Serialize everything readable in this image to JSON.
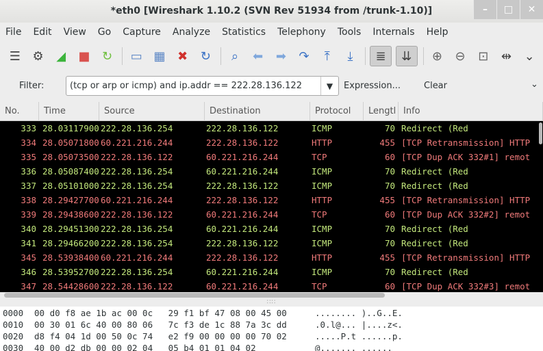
{
  "window": {
    "title": "*eth0  [Wireshark 1.10.2  (SVN Rev 51934 from /trunk-1.10)]",
    "controls": [
      "–",
      "□",
      "✕"
    ]
  },
  "menu": [
    "File",
    "Edit",
    "View",
    "Go",
    "Capture",
    "Analyze",
    "Statistics",
    "Telephony",
    "Tools",
    "Internals",
    "Help"
  ],
  "toolbar": [
    {
      "icon": "interfaces-icon",
      "glyph": "☰",
      "color": "#444444"
    },
    {
      "icon": "options-icon",
      "glyph": "⚙",
      "color": "#444444"
    },
    {
      "icon": "start-capture-icon",
      "glyph": "◢",
      "color": "#3cb43c"
    },
    {
      "icon": "stop-capture-icon",
      "glyph": "■",
      "color": "#d9534f"
    },
    {
      "icon": "restart-capture-icon",
      "glyph": "↻",
      "color": "#6fbf3f"
    },
    {
      "sep": true
    },
    {
      "icon": "open-file-icon",
      "glyph": "▭",
      "color": "#5b86c5"
    },
    {
      "icon": "save-file-icon",
      "glyph": "▦",
      "color": "#5b86c5"
    },
    {
      "icon": "close-file-icon",
      "glyph": "✖",
      "color": "#d0312d"
    },
    {
      "icon": "reload-icon",
      "glyph": "↻",
      "color": "#3a72c5"
    },
    {
      "sep": true
    },
    {
      "icon": "find-packet-icon",
      "glyph": "⌕",
      "color": "#3a72c5"
    },
    {
      "icon": "go-back-icon",
      "glyph": "⬅",
      "color": "#7fa7dc"
    },
    {
      "icon": "go-forward-icon",
      "glyph": "➡",
      "color": "#7fa7dc"
    },
    {
      "icon": "go-to-packet-icon",
      "glyph": "↷",
      "color": "#3a72c5"
    },
    {
      "icon": "first-packet-icon",
      "glyph": "⤒",
      "color": "#3a72c5"
    },
    {
      "icon": "last-packet-icon",
      "glyph": "⤓",
      "color": "#3a72c5"
    },
    {
      "sep": true
    },
    {
      "icon": "colorize-icon",
      "glyph": "≣",
      "color": "#444444",
      "pressed": true
    },
    {
      "icon": "autoscroll-icon",
      "glyph": "⇊",
      "color": "#444444",
      "pressed": true
    },
    {
      "sep": true
    },
    {
      "icon": "zoom-in-icon",
      "glyph": "⊕",
      "color": "#666666"
    },
    {
      "icon": "zoom-out-icon",
      "glyph": "⊖",
      "color": "#666666"
    },
    {
      "icon": "normal-size-icon",
      "glyph": "⊡",
      "color": "#666666"
    },
    {
      "icon": "resize-columns-icon",
      "glyph": "⇹",
      "color": "#444444"
    },
    {
      "icon": "more-tools-icon",
      "glyph": "⌄",
      "color": "#444444"
    }
  ],
  "filter": {
    "label": "Filter:",
    "value": "(tcp or arp or icmp) and ip.addr == 222.28.136.122",
    "expression_label": "Expression...",
    "clear_label": "Clear",
    "overflow_glyph": "⌄"
  },
  "packet_list": {
    "columns": [
      "No.",
      "Time",
      "Source",
      "Destination",
      "Protocol",
      "Lengtl",
      "Info"
    ],
    "rows": [
      {
        "no": "333",
        "time": "28.03117900(",
        "src": "222.28.136.254",
        "dst": "222.28.136.122",
        "proto": "ICMP",
        "len": "70",
        "info": "Redirect             (Red",
        "kind": "icmp"
      },
      {
        "no": "334",
        "time": "28.05071800(",
        "src": "60.221.216.244",
        "dst": "222.28.136.122",
        "proto": "HTTP",
        "len": "455",
        "info": "[TCP Retransmission] HTTP",
        "kind": "tcp"
      },
      {
        "no": "335",
        "time": "28.05073500(",
        "src": "222.28.136.122",
        "dst": "60.221.216.244",
        "proto": "TCP",
        "len": "60",
        "info": "[TCP Dup ACK 332#1] remot",
        "kind": "tcp"
      },
      {
        "no": "336",
        "time": "28.05087400(",
        "src": "222.28.136.254",
        "dst": "60.221.216.244",
        "proto": "ICMP",
        "len": "70",
        "info": "Redirect             (Red",
        "kind": "icmp"
      },
      {
        "no": "337",
        "time": "28.05101000(",
        "src": "222.28.136.254",
        "dst": "222.28.136.122",
        "proto": "ICMP",
        "len": "70",
        "info": "Redirect             (Red",
        "kind": "icmp"
      },
      {
        "no": "338",
        "time": "28.29427700(",
        "src": "60.221.216.244",
        "dst": "222.28.136.122",
        "proto": "HTTP",
        "len": "455",
        "info": "[TCP Retransmission] HTTP",
        "kind": "tcp"
      },
      {
        "no": "339",
        "time": "28.29438600(",
        "src": "222.28.136.122",
        "dst": "60.221.216.244",
        "proto": "TCP",
        "len": "60",
        "info": "[TCP Dup ACK 332#2] remot",
        "kind": "tcp"
      },
      {
        "no": "340",
        "time": "28.29451300(",
        "src": "222.28.136.254",
        "dst": "60.221.216.244",
        "proto": "ICMP",
        "len": "70",
        "info": "Redirect             (Red",
        "kind": "icmp"
      },
      {
        "no": "341",
        "time": "28.29466200(",
        "src": "222.28.136.254",
        "dst": "222.28.136.122",
        "proto": "ICMP",
        "len": "70",
        "info": "Redirect             (Red",
        "kind": "icmp"
      },
      {
        "no": "345",
        "time": "28.53938400(",
        "src": "60.221.216.244",
        "dst": "222.28.136.122",
        "proto": "HTTP",
        "len": "455",
        "info": "[TCP Retransmission] HTTP",
        "kind": "tcp"
      },
      {
        "no": "346",
        "time": "28.53952700(",
        "src": "222.28.136.254",
        "dst": "60.221.216.244",
        "proto": "ICMP",
        "len": "70",
        "info": "Redirect             (Red",
        "kind": "icmp"
      },
      {
        "no": "347",
        "time": "28.54428600(",
        "src": "222.28.136.122",
        "dst": "60.221.216.244",
        "proto": "TCP",
        "len": "60",
        "info": "[TCP Dup ACK 332#3] remot",
        "kind": "tcp"
      }
    ]
  },
  "splitter_glyph": "∷∷",
  "bytes": [
    {
      "offset": "0000",
      "hex": "00 d0 f8 ae 1b ac 00 0c   29 f1 bf 47 08 00 45 00",
      "ascii": "........ )..G..E."
    },
    {
      "offset": "0010",
      "hex": "00 30 01 6c 40 00 80 06   7c f3 de 1c 88 7a 3c dd",
      "ascii": ".0.l@... |....z<."
    },
    {
      "offset": "0020",
      "hex": "d8 f4 04 1d 00 50 0c 74   e2 f9 00 00 00 00 70 02",
      "ascii": ".....P.t ......p."
    },
    {
      "offset": "0030",
      "hex": "40 00 d2 db 00 00 02 04   05 b4 01 01 04 02",
      "ascii": "@....... ......"
    }
  ]
}
